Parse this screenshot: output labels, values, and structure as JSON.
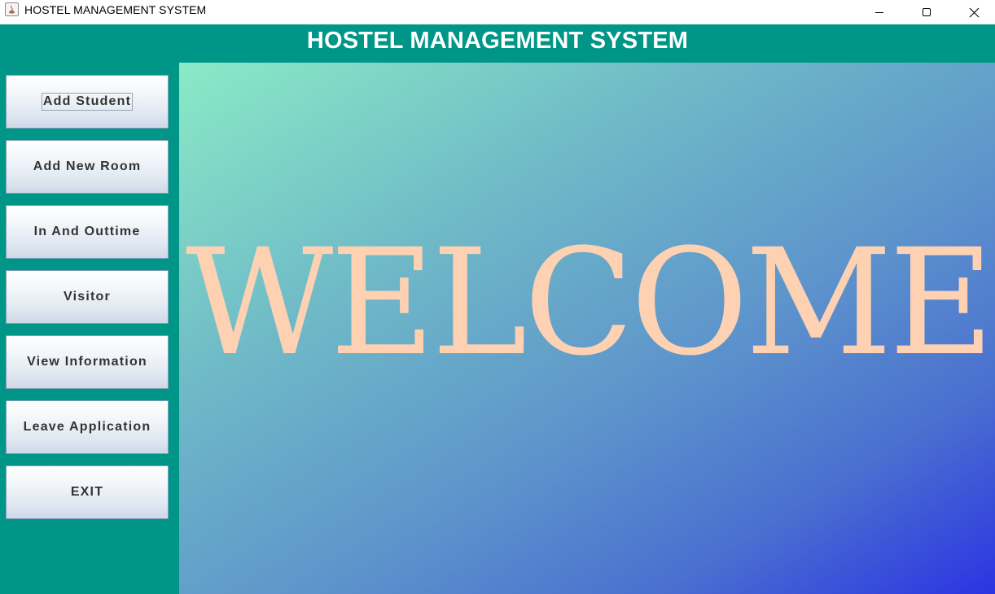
{
  "window": {
    "title": "HOSTEL MANAGEMENT SYSTEM",
    "icon": "java-icon"
  },
  "header": {
    "title": "HOSTEL MANAGEMENT SYSTEM"
  },
  "sidebar": {
    "items": [
      {
        "label": "Add Student"
      },
      {
        "label": "Add New Room"
      },
      {
        "label": "In And Outtime"
      },
      {
        "label": "Visitor"
      },
      {
        "label": "View Information"
      },
      {
        "label": "Leave Application"
      },
      {
        "label": "EXIT"
      }
    ]
  },
  "main": {
    "welcome": "WELCOME!"
  },
  "colors": {
    "header_bg": "#009687",
    "welcome_text": "#fdd1b2",
    "gradient_start": "#8aeac6",
    "gradient_end": "#2b34e2"
  }
}
